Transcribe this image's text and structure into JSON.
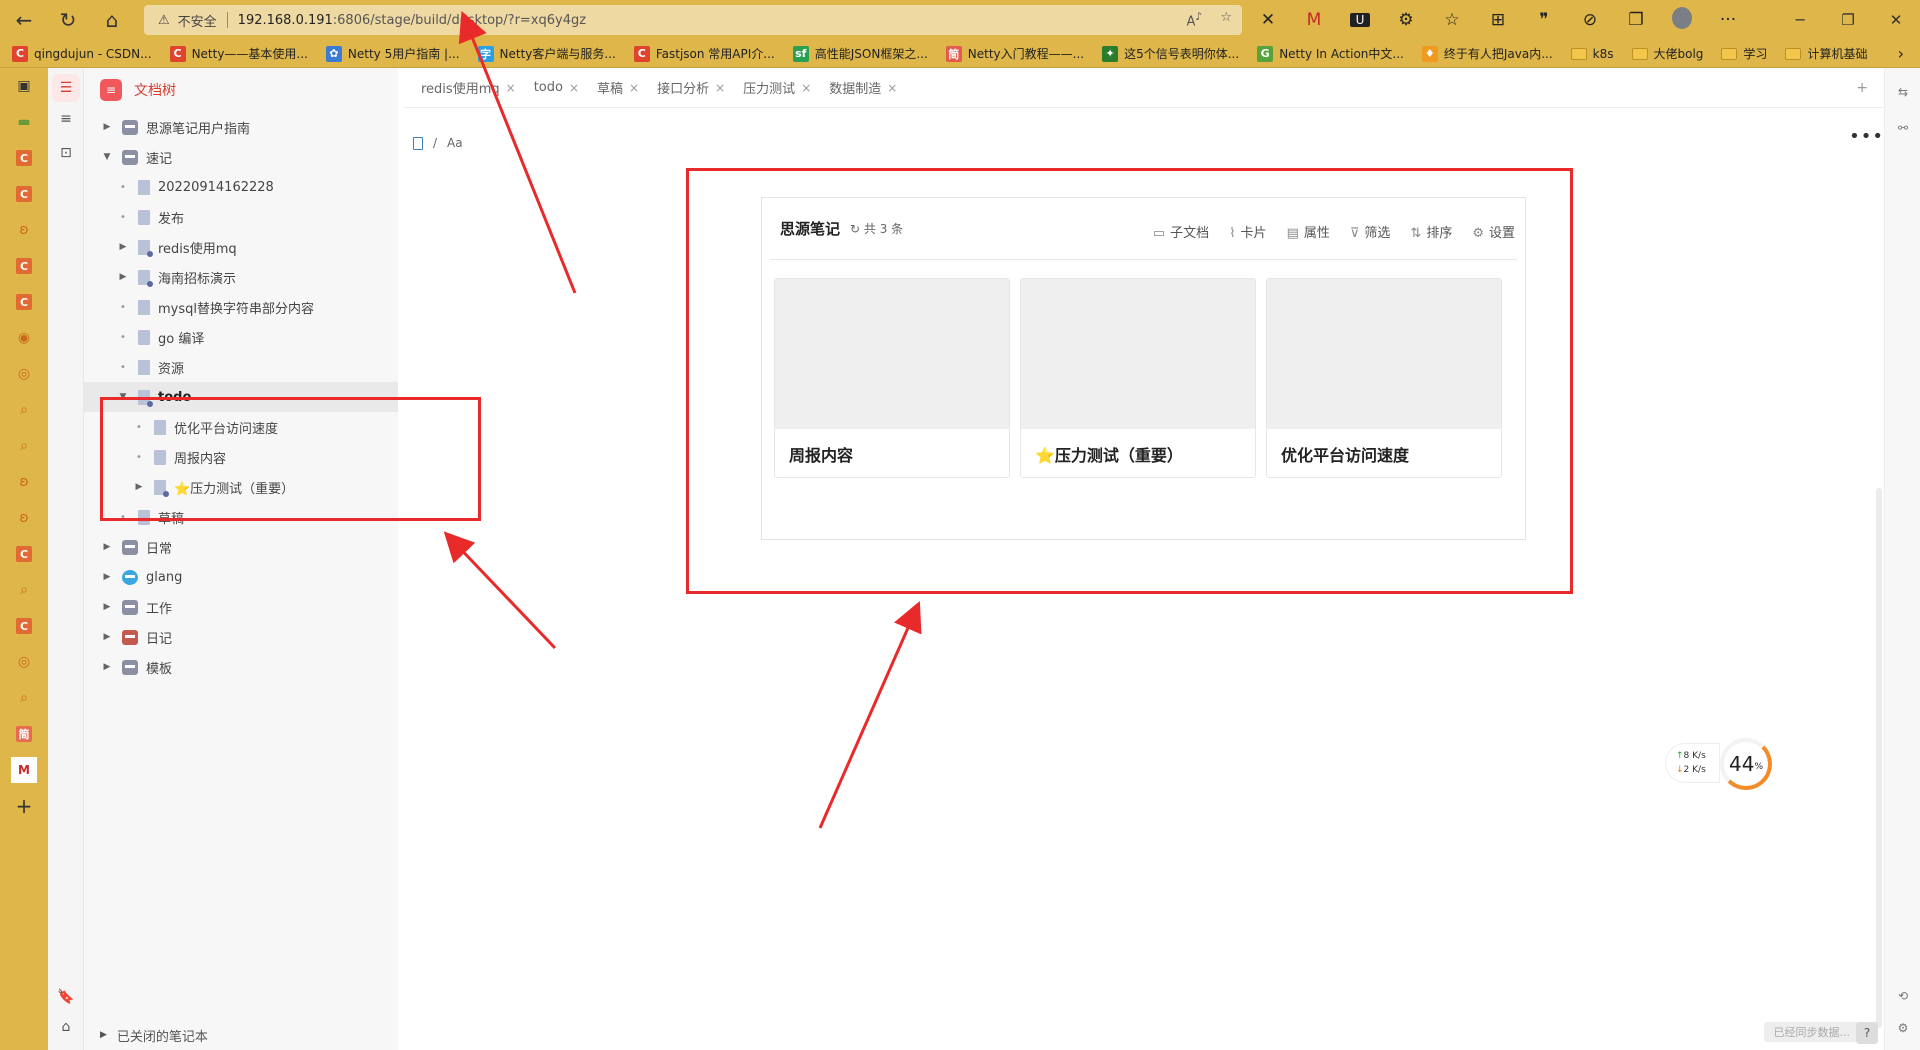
{
  "browser": {
    "insecure_label": "不安全",
    "url_main": "192.168.0.191",
    "url_rest": ":6806/stage/build/desktop/?r=xq6y4gz",
    "extensions": [
      "x-icon",
      "red-m-icon",
      "u-icon",
      "puzzle-icon",
      "favorites-icon",
      "collections-icon",
      "quote-icon",
      "shield-icon",
      "copy-icon"
    ],
    "more": "···"
  },
  "bookmarks": [
    {
      "label": "qingdujun - CSDN...",
      "icon": "C",
      "color": "#e0442f"
    },
    {
      "label": "Netty——基本使用...",
      "icon": "C",
      "color": "#e0442f"
    },
    {
      "label": "Netty 5用户指南 |...",
      "icon": "✿",
      "color": "#3a7bd5"
    },
    {
      "label": "Netty客户端与服务...",
      "icon": "字",
      "color": "#2a9ee6"
    },
    {
      "label": "Fastjson 常用API介...",
      "icon": "C",
      "color": "#e0442f"
    },
    {
      "label": "高性能JSON框架之...",
      "icon": "sf",
      "color": "#2a9f51"
    },
    {
      "label": "Netty入门教程——...",
      "icon": "简",
      "color": "#e25b4e"
    },
    {
      "label": "这5个信号表明你体...",
      "icon": "✦",
      "color": "#2a7d2a"
    },
    {
      "label": "Netty In Action中文...",
      "icon": "G",
      "color": "#58a23a"
    },
    {
      "label": "终于有人把Java内...",
      "icon": "♦",
      "color": "#f09a20"
    },
    {
      "label": "k8s",
      "icon": "folder",
      "color": "#f3c64b"
    },
    {
      "label": "大佬bolg",
      "icon": "folder",
      "color": "#f3c64b"
    },
    {
      "label": "学习",
      "icon": "folder",
      "color": "#f3c64b"
    },
    {
      "label": "计算机基础",
      "icon": "folder",
      "color": "#f3c64b"
    }
  ],
  "sidebar": {
    "title": "文档树",
    "items": [
      {
        "label": "思源笔记用户指南",
        "level": 0,
        "type": "notebook",
        "arrow": "▶"
      },
      {
        "label": "速记",
        "level": 0,
        "type": "notebook",
        "arrow": "▼"
      },
      {
        "label": "20220914162228",
        "level": 1,
        "type": "doc",
        "arrow": ""
      },
      {
        "label": "发布",
        "level": 1,
        "type": "doc",
        "arrow": ""
      },
      {
        "label": "redis使用mq",
        "level": 1,
        "type": "docsub",
        "arrow": "▶"
      },
      {
        "label": "海南招标演示",
        "level": 1,
        "type": "docsub",
        "arrow": "▶"
      },
      {
        "label": "mysql替换字符串部分内容",
        "level": 1,
        "type": "doc",
        "arrow": ""
      },
      {
        "label": "go 编译",
        "level": 1,
        "type": "doc",
        "arrow": ""
      },
      {
        "label": "资源",
        "level": 1,
        "type": "doc",
        "arrow": ""
      },
      {
        "label": "todo",
        "level": 1,
        "type": "docsub",
        "arrow": "▼",
        "selected": true
      },
      {
        "label": "优化平台访问速度",
        "level": 2,
        "type": "doc",
        "arrow": ""
      },
      {
        "label": "周报内容",
        "level": 2,
        "type": "doc",
        "arrow": ""
      },
      {
        "label": "⭐压力测试（重要）",
        "level": 2,
        "type": "docsub",
        "arrow": "▶"
      },
      {
        "label": "草稿",
        "level": 1,
        "type": "doc",
        "arrow": ""
      },
      {
        "label": "日常",
        "level": 0,
        "type": "notebook",
        "arrow": "▶"
      },
      {
        "label": "glang",
        "level": 0,
        "type": "notebook-blue",
        "arrow": "▶"
      },
      {
        "label": "工作",
        "level": 0,
        "type": "notebook",
        "arrow": "▶"
      },
      {
        "label": "日记",
        "level": 0,
        "type": "notebook-red",
        "arrow": "▶"
      },
      {
        "label": "模板",
        "level": 0,
        "type": "notebook",
        "arrow": "▶"
      }
    ],
    "closed_notebooks": "已关闭的笔记本"
  },
  "tabs": [
    {
      "label": "redis使用mq"
    },
    {
      "label": "todo"
    },
    {
      "label": "草稿"
    },
    {
      "label": "接口分析"
    },
    {
      "label": "压力测试"
    },
    {
      "label": "数据制造"
    }
  ],
  "tab_actions": {
    "add": "+",
    "dropdown": "▾"
  },
  "breadcrumb": {
    "item": "Aa"
  },
  "database_view": {
    "title": "思源笔记",
    "count": "共 3 条",
    "buttons": [
      {
        "icon": "▭",
        "label": "子文档"
      },
      {
        "icon": "⌇",
        "label": "卡片"
      },
      {
        "icon": "▤",
        "label": "属性"
      },
      {
        "icon": "⊽",
        "label": "筛选"
      },
      {
        "icon": "⇅",
        "label": "排序"
      },
      {
        "icon": "⚙",
        "label": "设置"
      }
    ],
    "cards": [
      {
        "title": "周报内容"
      },
      {
        "title": "⭐压力测试（重要）"
      },
      {
        "title": "优化平台访问速度"
      }
    ]
  },
  "net_widget": {
    "up": "8",
    "down": "2",
    "unit": "K/s",
    "percent": "44",
    "percent_sign": "%"
  },
  "status": {
    "sync": "已经同步数据...",
    "help": "?"
  },
  "colors": {
    "annotation": "#e92a2a",
    "accent": "#d23f31",
    "browser_theme": "#dfb64a"
  }
}
